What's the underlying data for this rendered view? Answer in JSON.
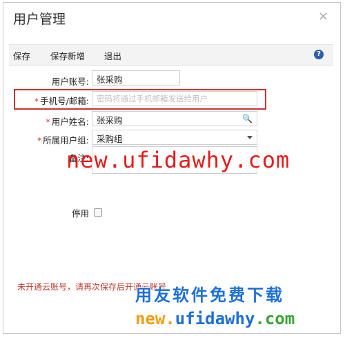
{
  "dialog": {
    "title": "用户管理",
    "close_glyph": "×"
  },
  "toolbar": {
    "save_label": "保存",
    "save_new_label": "保存新增",
    "exit_label": "退出",
    "help_glyph": "?"
  },
  "form": {
    "account": {
      "label": "用户账号:",
      "value": "张采购"
    },
    "phone": {
      "label": "手机号/邮箱:",
      "placeholder": "密码将通过手机邮箱发送给用户"
    },
    "name": {
      "label": "用户姓名:",
      "value": "张采购",
      "icon": "search-icon"
    },
    "group": {
      "label": "所属用户组:",
      "value": "采购组",
      "icon": "chevron-down-icon"
    },
    "remark": {
      "label": "备注:",
      "value": ""
    },
    "disabled": {
      "label": "停用",
      "checked": false
    }
  },
  "warning": "未开通云账号，请再次保存后开通云账号",
  "watermarks": {
    "url_red": "new.ufidawhy.com",
    "slogan": "用友软件免费下载",
    "url_color": [
      "new.",
      "ufidawhy",
      ".com"
    ]
  },
  "colors": {
    "required_star": "#d23030",
    "highlight_border": "#d0312f",
    "warning_text": "#c0392b",
    "help_icon": "#2c5fa8"
  }
}
